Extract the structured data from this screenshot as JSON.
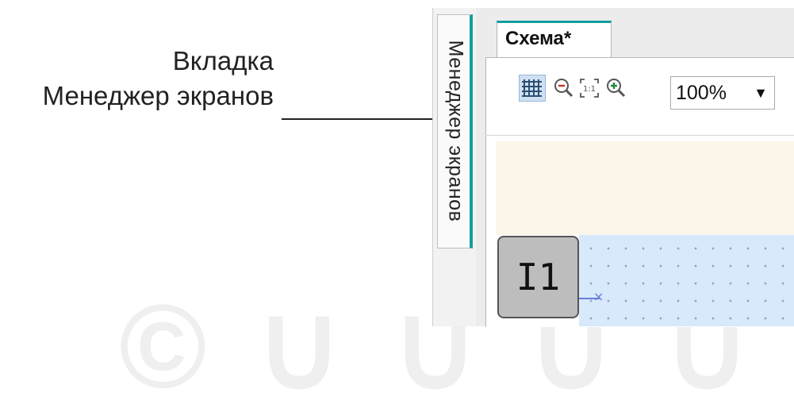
{
  "callout": {
    "line1": "Вкладка",
    "line2": "Менеджер экранов"
  },
  "side_tab": {
    "label": "Менеджер экранов"
  },
  "document_tab": {
    "label": "Схема*"
  },
  "toolbar": {
    "zoom_value": "100%",
    "icons": [
      "grid-icon",
      "zoom-out-icon",
      "fit-1to1-icon",
      "zoom-in-icon",
      "chevron-down-icon"
    ]
  },
  "canvas": {
    "block_label": "I1"
  },
  "colors": {
    "accent": "#129d9d",
    "canvas_blue": "#d7e9fa",
    "cream": "#fcf6ea",
    "block_gray": "#bdbdbd"
  }
}
